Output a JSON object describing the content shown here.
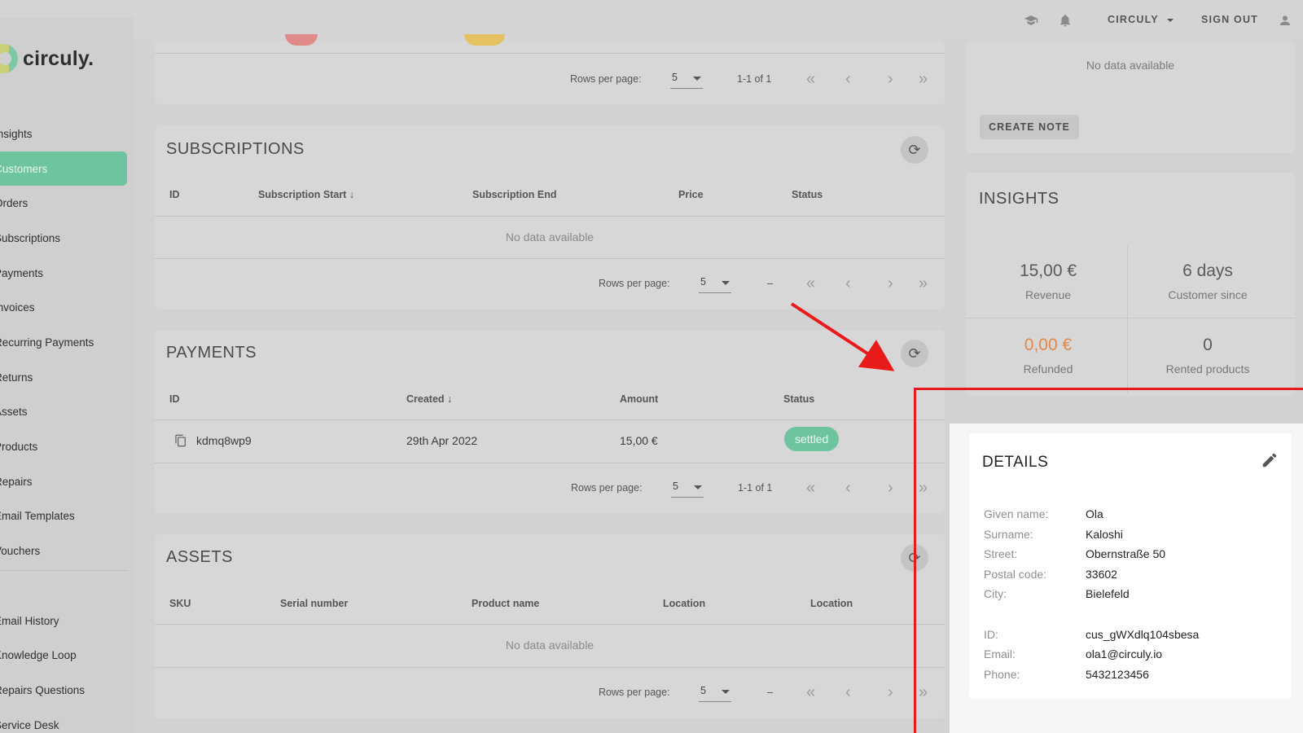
{
  "app": {
    "logo_text": "circuly."
  },
  "topbar": {
    "tenant_label": "CIRCULY",
    "sign_out_label": "SIGN OUT",
    "icons": [
      "graduation-cap-icon",
      "bell-icon",
      "user-icon"
    ]
  },
  "sidebar": {
    "items": [
      {
        "label": "Insights"
      },
      {
        "label": "Customers",
        "active": true
      },
      {
        "label": "Orders"
      },
      {
        "label": "Subscriptions"
      },
      {
        "label": "Payments"
      },
      {
        "label": "Invoices"
      },
      {
        "label": "Recurring Payments"
      },
      {
        "label": "Returns"
      },
      {
        "label": "Assets"
      },
      {
        "label": "Products"
      },
      {
        "label": "Repairs"
      },
      {
        "label": "Email Templates"
      },
      {
        "label": "Vouchers"
      }
    ],
    "secondary_items": [
      {
        "label": "Email History"
      },
      {
        "label": "Knowledge Loop"
      },
      {
        "label": "Repairs Questions"
      },
      {
        "label": "Service Desk"
      }
    ]
  },
  "top_pager": {
    "rows_label": "Rows per page:",
    "rows_value": "5",
    "range": "1-1 of 1"
  },
  "subscriptions": {
    "title": "SUBSCRIPTIONS",
    "columns": [
      "ID",
      "Subscription Start",
      "Subscription End",
      "Price",
      "Status"
    ],
    "sort_column": "Subscription Start",
    "empty_text": "No data available",
    "pager": {
      "rows_label": "Rows per page:",
      "rows_value": "5",
      "range": "–"
    }
  },
  "payments": {
    "title": "PAYMENTS",
    "columns": [
      "ID",
      "Created",
      "Amount",
      "Status"
    ],
    "sort_column": "Created",
    "rows": [
      {
        "id": "kdmq8wp9",
        "created": "29th Apr 2022",
        "amount": "15,00 €",
        "status": "settled"
      }
    ],
    "pager": {
      "rows_label": "Rows per page:",
      "rows_value": "5",
      "range": "1-1 of 1"
    }
  },
  "assets": {
    "title": "ASSETS",
    "columns": [
      "SKU",
      "Serial number",
      "Product name",
      "Location",
      "Location"
    ],
    "empty_text": "No data available",
    "pager": {
      "rows_label": "Rows per page:",
      "rows_value": "5",
      "range": "–"
    }
  },
  "notes": {
    "empty_text": "No data available",
    "create_label": "CREATE NOTE"
  },
  "insights": {
    "title": "INSIGHTS",
    "stats": [
      {
        "value": "15,00 €",
        "label": "Revenue"
      },
      {
        "value": "6 days",
        "label": "Customer since"
      },
      {
        "value": "0,00 €",
        "label": "Refunded",
        "color": "#e0894a"
      },
      {
        "value": "0",
        "label": "Rented products"
      }
    ]
  },
  "details": {
    "title": "DETAILS",
    "fields": [
      {
        "label": "Given name:",
        "value": "Ola"
      },
      {
        "label": "Surname:",
        "value": "Kaloshi"
      },
      {
        "label": "Street:",
        "value": "Obernstraße 50"
      },
      {
        "label": "Postal code:",
        "value": "33602"
      },
      {
        "label": "City:",
        "value": "Bielefeld"
      },
      {
        "label": "ID:",
        "value": "cus_gWXdlq104sbesa"
      },
      {
        "label": "Email:",
        "value": "ola1@circuly.io"
      },
      {
        "label": "Phone:",
        "value": "5432123456"
      }
    ]
  },
  "colors": {
    "accent": "#6ec49f",
    "annotation": "#e81a1a",
    "refunded": "#e0894a"
  }
}
